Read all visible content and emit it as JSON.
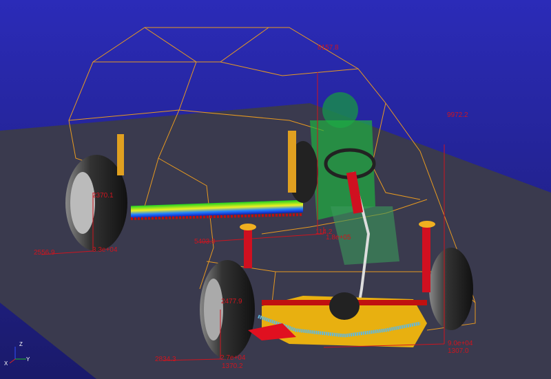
{
  "viewport": {
    "background_top": "#2b2bb8",
    "background_bottom": "#1a1a6a",
    "ground_color": "#3a3a4e",
    "wireframe_color": "#e89a20",
    "force_color": "#d0141e"
  },
  "force_labels": [
    {
      "id": "rear-left-vertical",
      "text": "2370.1"
    },
    {
      "id": "rear-left-lateral",
      "text": "2556.9"
    },
    {
      "id": "rear-left-magnitude",
      "text": "3.3e+04"
    },
    {
      "id": "rear-right-lateral",
      "text": "5403.3"
    },
    {
      "id": "rear-right-vertical",
      "text": "114.2"
    },
    {
      "id": "rear-right-magnitude",
      "text": "1.8e+05"
    },
    {
      "id": "front-left-vertical",
      "text": "2477.9"
    },
    {
      "id": "front-left-lateral",
      "text": "2834.3"
    },
    {
      "id": "front-left-magnitude",
      "text": "2.7e+04"
    },
    {
      "id": "front-left-longitudinal",
      "text": "1370.2"
    },
    {
      "id": "front-right-magnitude",
      "text": "9.0e+04"
    },
    {
      "id": "front-right-longitudinal",
      "text": "1307.0"
    },
    {
      "id": "roof-vertical-1",
      "text": "8157.8"
    },
    {
      "id": "roof-vertical-2",
      "text": "9972.2"
    }
  ],
  "axis_triad": {
    "x": "X",
    "y": "Y",
    "z": "Z"
  }
}
